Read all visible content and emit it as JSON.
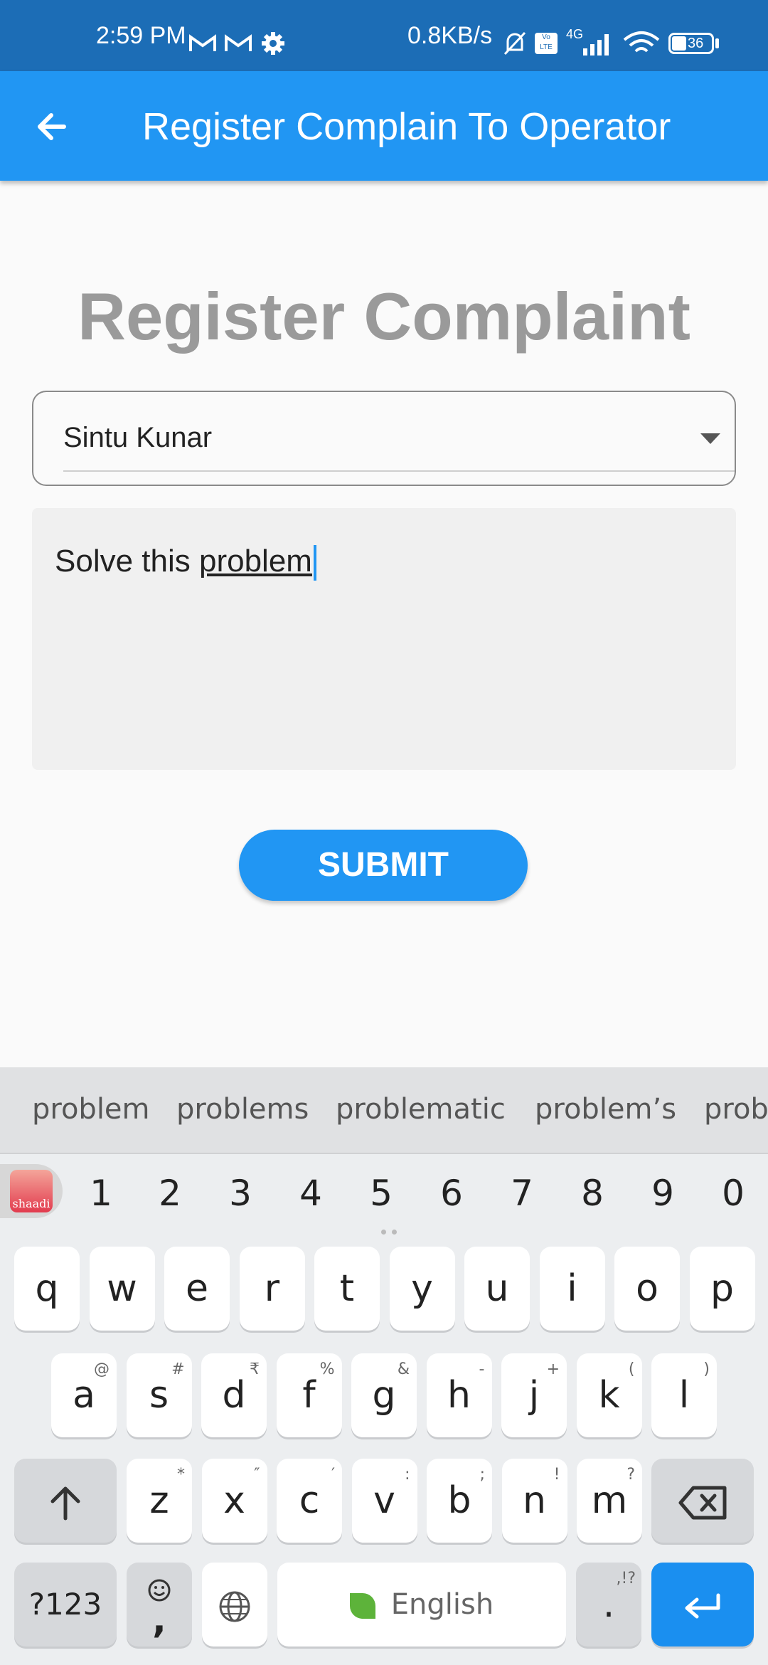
{
  "status_bar": {
    "time": "2:59 PM",
    "net_speed": "0.8KB/s",
    "network": "4G",
    "volte": "Vo LTE",
    "battery": "36"
  },
  "app_bar": {
    "title": "Register Complain To Operator",
    "back_icon": "arrow-back-icon"
  },
  "form": {
    "heading": "Register Complaint",
    "operator_select": {
      "selected": "Sintu Kunar"
    },
    "complaint": {
      "text_prefix": "Solve this ",
      "text_current_word": "problem"
    },
    "submit_label": "SUBMIT"
  },
  "keyboard": {
    "suggestions": [
      "problem",
      "problems",
      "problematic",
      "problem’s",
      "probl"
    ],
    "number_row": [
      "1",
      "2",
      "3",
      "4",
      "5",
      "6",
      "7",
      "8",
      "9",
      "0"
    ],
    "row1": [
      {
        "k": "q",
        "h": ""
      },
      {
        "k": "w",
        "h": ""
      },
      {
        "k": "e",
        "h": ""
      },
      {
        "k": "r",
        "h": ""
      },
      {
        "k": "t",
        "h": ""
      },
      {
        "k": "y",
        "h": ""
      },
      {
        "k": "u",
        "h": ""
      },
      {
        "k": "i",
        "h": ""
      },
      {
        "k": "o",
        "h": ""
      },
      {
        "k": "p",
        "h": ""
      }
    ],
    "row2": [
      {
        "k": "a",
        "h": "@"
      },
      {
        "k": "s",
        "h": "#"
      },
      {
        "k": "d",
        "h": "₹"
      },
      {
        "k": "f",
        "h": "%"
      },
      {
        "k": "g",
        "h": "&"
      },
      {
        "k": "h",
        "h": "-"
      },
      {
        "k": "j",
        "h": "+"
      },
      {
        "k": "k",
        "h": "("
      },
      {
        "k": "l",
        "h": ")"
      }
    ],
    "row3": [
      {
        "k": "z",
        "h": "*"
      },
      {
        "k": "x",
        "h": "″"
      },
      {
        "k": "c",
        "h": "′"
      },
      {
        "k": "v",
        "h": ":"
      },
      {
        "k": "b",
        "h": ";"
      },
      {
        "k": "n",
        "h": "!"
      },
      {
        "k": "m",
        "h": "?"
      }
    ],
    "symbols_label": "?123",
    "emoji_label": ",",
    "space_label": "English",
    "period_label": ".",
    "period_hint": ",!?",
    "shaadi_label": "shaadi"
  }
}
